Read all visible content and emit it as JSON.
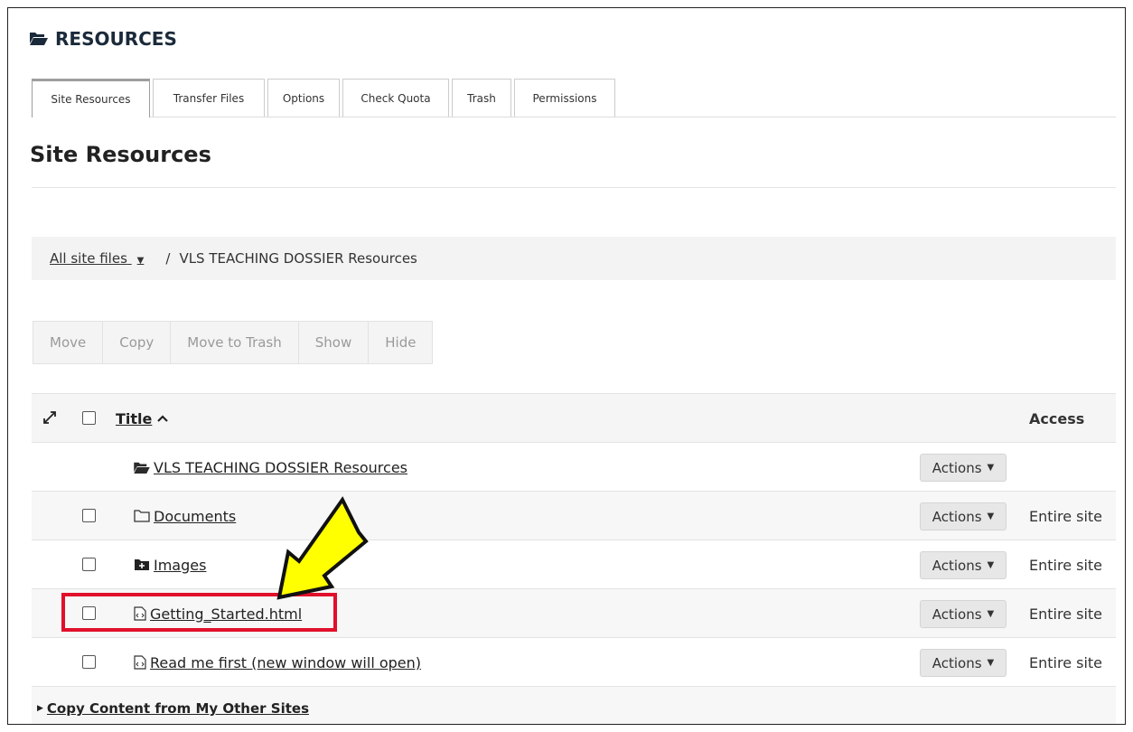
{
  "header": {
    "title": "RESOURCES"
  },
  "tabs": [
    {
      "label": "Site Resources"
    },
    {
      "label": "Transfer Files"
    },
    {
      "label": "Options"
    },
    {
      "label": "Check Quota"
    },
    {
      "label": "Trash"
    },
    {
      "label": "Permissions"
    }
  ],
  "page_title": "Site Resources",
  "breadcrumb": {
    "root": "All site files",
    "separator": "/",
    "current": "VLS TEACHING DOSSIER Resources"
  },
  "toolbar": {
    "move": "Move",
    "copy": "Copy",
    "trash": "Move to Trash",
    "show": "Show",
    "hide": "Hide"
  },
  "table": {
    "title_header": "Title",
    "access_header": "Access",
    "rows": [
      {
        "name": "VLS TEACHING DOSSIER Resources",
        "action": "Actions",
        "access": ""
      },
      {
        "name": "Documents",
        "action": "Actions",
        "access": "Entire site"
      },
      {
        "name": "Images",
        "action": "Actions",
        "access": "Entire site"
      },
      {
        "name": "Getting_Started.html",
        "action": "Actions",
        "access": "Entire site"
      },
      {
        "name": "Read me first (new window will open)",
        "action": "Actions",
        "access": "Entire site"
      }
    ]
  },
  "copy_link": "Copy Content from My Other Sites",
  "colors": {
    "highlight_box": "#e0102b",
    "arrow_fill": "#ffff00"
  }
}
